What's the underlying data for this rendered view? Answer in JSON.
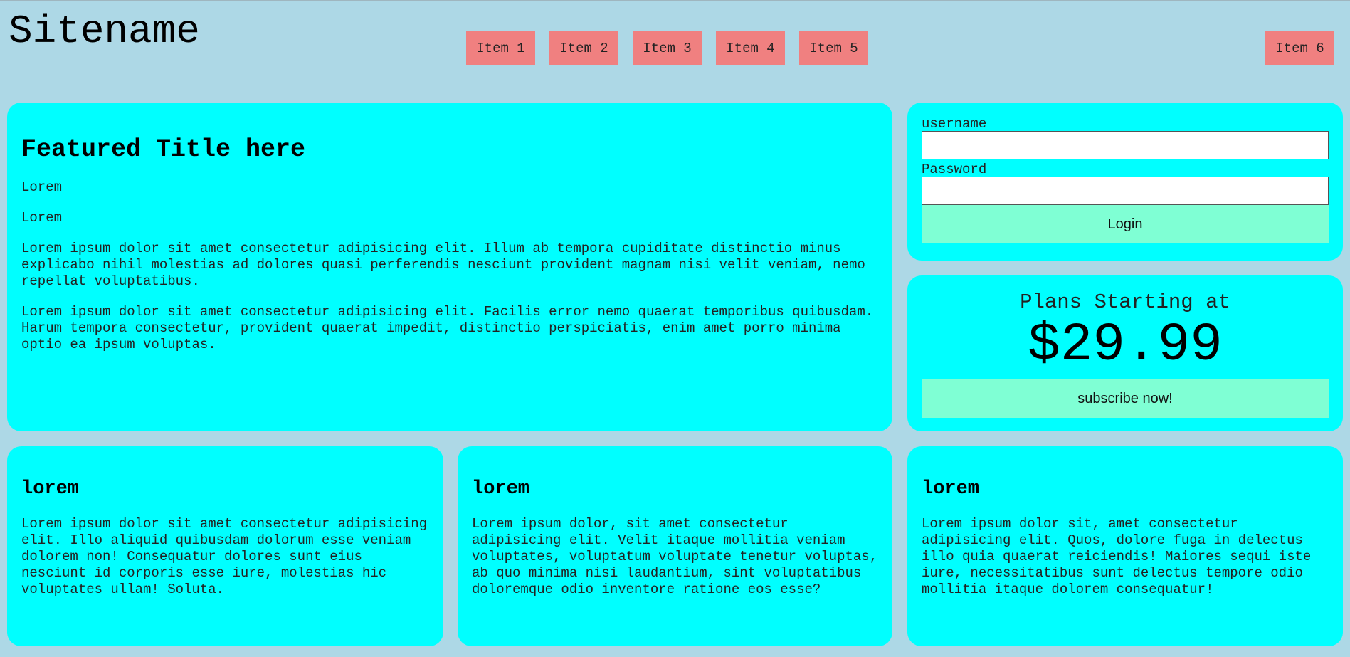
{
  "header": {
    "sitename": "Sitename"
  },
  "nav": {
    "items": [
      {
        "label": "Item 1"
      },
      {
        "label": "Item 2"
      },
      {
        "label": "Item 3"
      },
      {
        "label": "Item 4"
      },
      {
        "label": "Item 5"
      },
      {
        "label": "Item 6"
      }
    ]
  },
  "featured": {
    "title": "Featured Title here",
    "lines": [
      "Lorem",
      "Lorem"
    ],
    "paragraphs": [
      "Lorem ipsum dolor sit amet consectetur adipisicing elit. Illum ab tempora cupiditate distinctio minus explicabo nihil molestias ad dolores quasi perferendis nesciunt provident magnam nisi velit veniam, nemo repellat voluptatibus.",
      "Lorem ipsum dolor sit amet consectetur adipisicing elit. Facilis error nemo quaerat temporibus quibusdam. Harum tempora consectetur, provident quaerat impedit, distinctio perspiciatis, enim amet porro minima optio ea ipsum voluptas."
    ]
  },
  "login": {
    "username_label": "username",
    "username_value": "",
    "password_label": "Password",
    "password_value": "",
    "button_label": "Login"
  },
  "plans": {
    "label": "Plans Starting at",
    "price": "$29.99",
    "button_label": "subscribe now!"
  },
  "cards": [
    {
      "title": "lorem",
      "text": "Lorem ipsum dolor sit amet consectetur adipisicing elit. Illo aliquid quibusdam dolorum esse veniam dolorem non! Consequatur dolores sunt eius nesciunt id corporis esse iure, molestias hic voluptates ullam! Soluta."
    },
    {
      "title": "lorem",
      "text": "Lorem ipsum dolor, sit amet consectetur adipisicing elit. Velit itaque mollitia veniam voluptates, voluptatum voluptate tenetur voluptas, ab quo minima nisi laudantium, sint voluptatibus doloremque odio inventore ratione eos esse?"
    },
    {
      "title": "lorem",
      "text": "Lorem ipsum dolor sit, amet consectetur adipisicing elit. Quos, dolore fuga in delectus illo quia quaerat reiciendis! Maiores sequi iste iure, necessitatibus sunt delectus tempore odio mollitia itaque dolorem consequatur!"
    }
  ],
  "colors": {
    "background": "#add8e6",
    "card": "#00ffff",
    "nav_item": "#f08080",
    "button": "#7fffd4"
  }
}
